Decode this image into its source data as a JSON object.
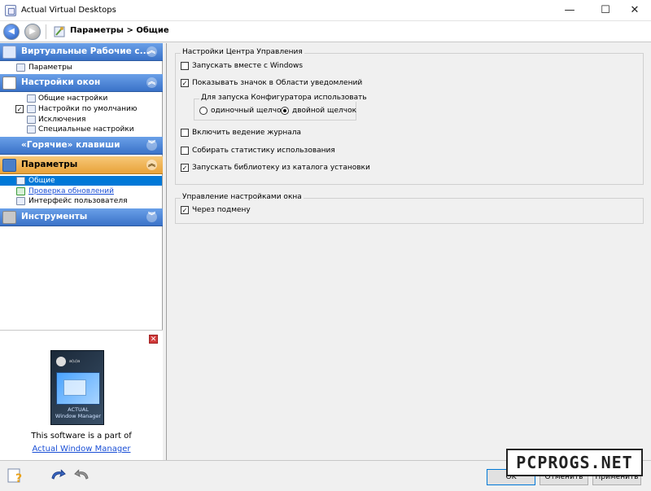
{
  "window": {
    "title": "Actual Virtual Desktops",
    "minimize": "—",
    "maximize": "☐",
    "close": "✕"
  },
  "toolbar": {
    "breadcrumb": "Параметры > Общие"
  },
  "sidebar": {
    "group_virtual": {
      "label": "Виртуальные Рабочие с...",
      "items": [
        "Параметры"
      ]
    },
    "group_window": {
      "label": "Настройки окон",
      "items": [
        "Общие настройки",
        "Настройки по умолчанию",
        "Исключения",
        "Специальные настройки"
      ]
    },
    "group_hotkeys": {
      "label": "«Горячие» клавиши"
    },
    "group_params": {
      "label": "Параметры",
      "items": [
        "Общие",
        "Проверка обновлений",
        "Интерфейс пользователя"
      ]
    },
    "group_tools": {
      "label": "Инструменты"
    }
  },
  "ad": {
    "brand_line1": "ACTUAL",
    "brand_line2": "Window Manager",
    "text": "This software is a part of",
    "link": "Actual Window Manager"
  },
  "content": {
    "control_center": {
      "title": "Настройки Центра Управления",
      "startup": {
        "label": "Запускать вместе с Windows",
        "checked": false
      },
      "tray_icon": {
        "label": "Показывать значок в Области уведомлений",
        "checked": true
      },
      "launch_group": {
        "title": "Для запуска Конфигуратора использовать",
        "single": "одиночный щелчок",
        "double": "двойной щелчок",
        "selected": "double"
      },
      "logging": {
        "label": "Включить ведение журнала",
        "checked": false
      },
      "stats": {
        "label": "Собирать статистику использования",
        "checked": false
      },
      "library": {
        "label": "Запускать библиотеку из каталога установки",
        "checked": true
      }
    },
    "window_mgmt": {
      "title": "Управление настройками окна",
      "substitution": {
        "label": "Через подмену",
        "checked": true
      }
    }
  },
  "buttons": {
    "ok": "OK",
    "cancel": "Отменить",
    "apply": "Применить"
  },
  "watermark": "PCPROGS.NET"
}
